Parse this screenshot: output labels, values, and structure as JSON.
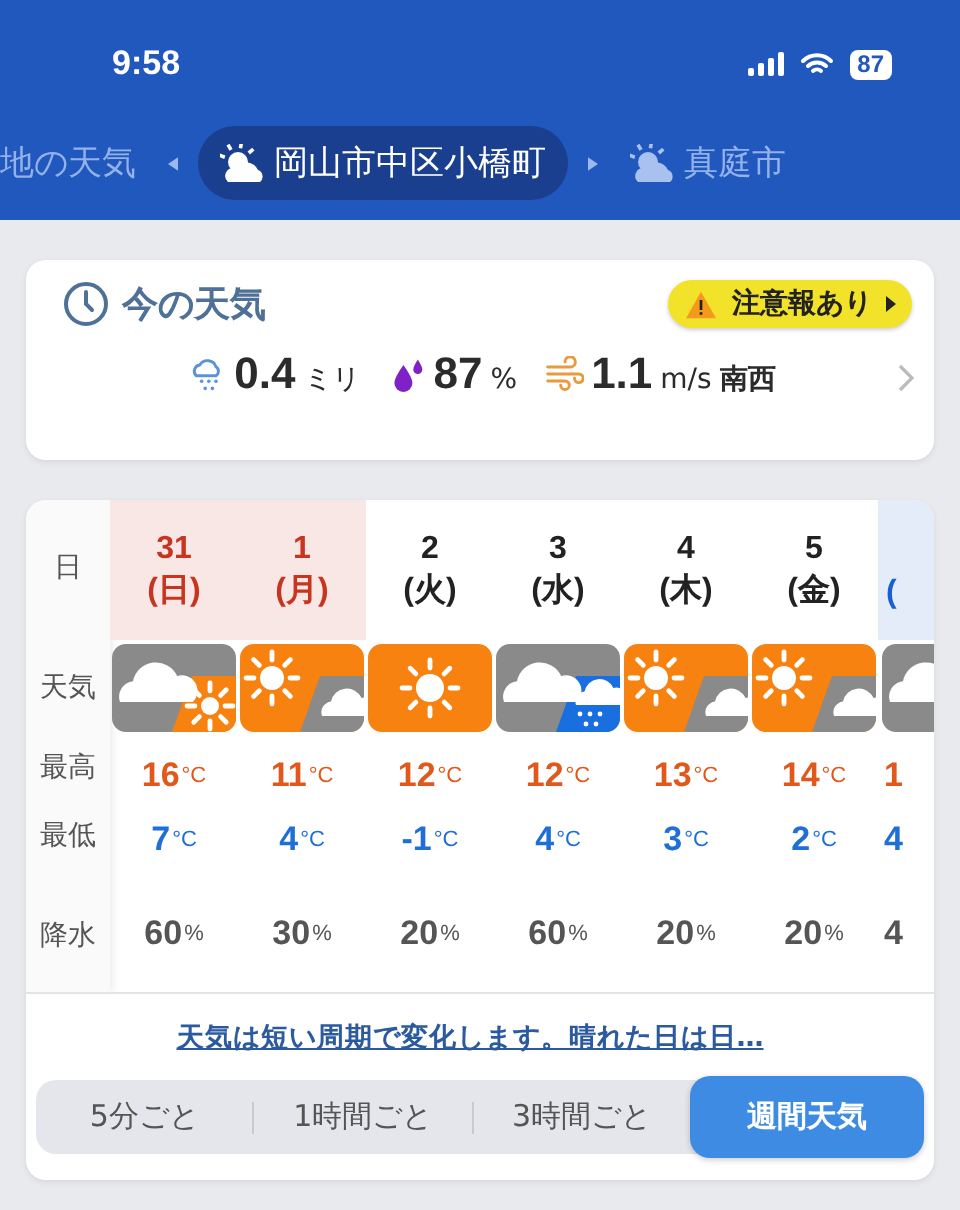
{
  "status_bar": {
    "time": "9:58",
    "battery": "87"
  },
  "location_tabs": [
    {
      "label": "地の天気",
      "icon": false,
      "selected": false
    },
    {
      "label": "岡山市中区小橋町",
      "icon": true,
      "selected": true
    },
    {
      "label": "真庭市",
      "icon": true,
      "selected": false
    }
  ],
  "current": {
    "title": "今の天気",
    "alert": "注意報あり",
    "items": [
      {
        "kind": "rain",
        "value": "0.4",
        "unit": "ミリ"
      },
      {
        "kind": "humidity",
        "value": "87",
        "unit": "%"
      },
      {
        "kind": "wind",
        "value": "1.1",
        "unit": "m/s",
        "direction": "南西"
      }
    ]
  },
  "weekly": {
    "row_labels": [
      "日",
      "天気",
      "最高",
      "最低",
      "降水"
    ],
    "days": [
      {
        "date": "31",
        "weekday": "(日)",
        "color": "#c8351f",
        "shaded": true,
        "kind": "cloud-sun",
        "high": "16",
        "high_unit": "°C",
        "low": "7",
        "low_unit": "°C",
        "precip": "60",
        "precip_unit": "%"
      },
      {
        "date": "1",
        "weekday": "(月)",
        "color": "#c8351f",
        "shaded": true,
        "kind": "sun-cloud",
        "high": "11",
        "high_unit": "°C",
        "low": "4",
        "low_unit": "°C",
        "precip": "30",
        "precip_unit": "%"
      },
      {
        "date": "2",
        "weekday": "(火)",
        "color": "#222222",
        "shaded": false,
        "kind": "sun",
        "high": "12",
        "high_unit": "°C",
        "low": "-1",
        "low_unit": "°C",
        "precip": "20",
        "precip_unit": "%"
      },
      {
        "date": "3",
        "weekday": "(水)",
        "color": "#222222",
        "shaded": false,
        "kind": "cloud-rain",
        "high": "12",
        "high_unit": "°C",
        "low": "4",
        "low_unit": "°C",
        "precip": "60",
        "precip_unit": "%"
      },
      {
        "date": "4",
        "weekday": "(木)",
        "color": "#222222",
        "shaded": false,
        "kind": "sun-cloud",
        "high": "13",
        "high_unit": "°C",
        "low": "3",
        "low_unit": "°C",
        "precip": "20",
        "precip_unit": "%"
      },
      {
        "date": "5",
        "weekday": "(金)",
        "color": "#222222",
        "shaded": false,
        "kind": "sun-cloud",
        "high": "14",
        "high_unit": "°C",
        "low": "2",
        "low_unit": "°C",
        "precip": "20",
        "precip_unit": "%"
      },
      {
        "weekday": "(",
        "color": "#1a5fd0",
        "shaded": true,
        "kind": "cloud",
        "high": "1",
        "low": "4",
        "precip": "4"
      }
    ]
  },
  "note_link": "天気は短い周期で変化します。晴れた日は日…",
  "segments": [
    {
      "label": "5分ごと",
      "selected": false
    },
    {
      "label": "1時間ごと",
      "selected": false
    },
    {
      "label": "3時間ごと",
      "selected": false
    },
    {
      "label": "週間天気",
      "selected": true
    }
  ]
}
